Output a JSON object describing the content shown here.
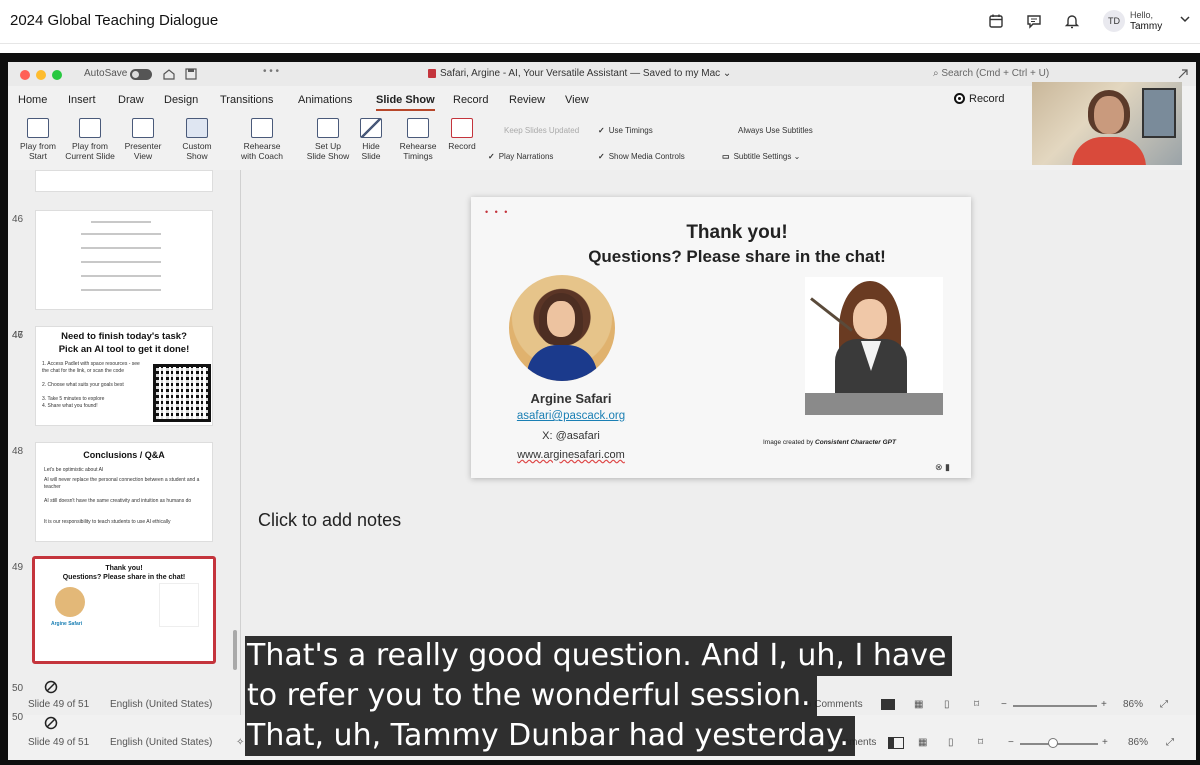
{
  "meeting": {
    "title": "2024 Global Teaching Dialogue",
    "avatar_initials": "TD",
    "greeting": "Hello,",
    "user_name": "Tammy"
  },
  "ppt": {
    "autosave_label": "AutoSave",
    "doc_title": "Safari, Argine - AI, Your Versatile Assistant  — Saved to my Mac ⌄",
    "search_placeholder": "Search (Cmd + Ctrl + U)",
    "menu": [
      "Home",
      "Insert",
      "Draw",
      "Design",
      "Transitions",
      "Animations",
      "Slide Show",
      "Record",
      "Review",
      "View"
    ],
    "active_menu": "Slide Show",
    "record_label": "Record",
    "ribbon": [
      {
        "l1": "Play from",
        "l2": "Start"
      },
      {
        "l1": "Play from",
        "l2": "Current Slide"
      },
      {
        "l1": "Presenter",
        "l2": "View"
      },
      {
        "l1": "Custom",
        "l2": "Show"
      },
      {
        "l1": "Rehearse",
        "l2": "with Coach"
      },
      {
        "l1": "Set Up",
        "l2": "Slide Show"
      },
      {
        "l1": "Hide",
        "l2": "Slide"
      },
      {
        "l1": "Rehearse",
        "l2": "Timings"
      },
      {
        "l1": "Record",
        "l2": ""
      }
    ],
    "options": {
      "keep_slides_updated": "Keep Slides Updated",
      "use_timings": "Use Timings",
      "always_use_subtitles": "Always Use Subtitles",
      "play_narrations": "Play Narrations",
      "show_media_controls": "Show Media Controls",
      "subtitle_settings": "Subtitle Settings ⌄"
    }
  },
  "slides_panel": {
    "numbers": [
      "46",
      "47",
      "48",
      "49",
      "50"
    ],
    "s47": {
      "title1": "Need to finish today's task?",
      "title2": "Pick an AI tool to get it done!",
      "bullets": [
        "1. Access Padlet with space resources - see the chat for the link, or scan the code",
        "2. Choose what suits your goals best",
        "3. Take 5 minutes to explore",
        "4. Share what you found!"
      ]
    },
    "s48": {
      "title": "Conclusions / Q&A",
      "bullets": [
        "Let's be optimistic about AI",
        "AI will never replace the personal connection between a student and a teacher",
        "AI still doesn't have the same creativity and intuition as humans do",
        "It is our responsibility to teach students to use AI ethically"
      ]
    },
    "s49": {
      "title1": "Thank you!",
      "title2": "Questions? Please share in the chat!",
      "name": "Argine Safari"
    }
  },
  "slide": {
    "title1": "Thank you!",
    "title2": "Questions? Please share in the chat!",
    "presenter_name": "Argine Safari",
    "email": "asafari@pascack.org",
    "x_handle": "X: @asafari",
    "website": "www.arginesafari.com",
    "credit_prefix": "Image created by",
    "credit_tool": "Consistent Character GPT"
  },
  "notes_placeholder": "Click to add notes",
  "status_bar": {
    "slide_count_back": "Slide 49 of 51",
    "slide_count": "Slide 49 of 51",
    "language": "English (United States)",
    "comments": "Comments",
    "zoom": "86%"
  },
  "captions": {
    "line1": "That's a really good question. And I, uh, I have",
    "line2": "to refer you to the wonderful session.",
    "line3a": "That, uh, Tammy Dunbar",
    "line3b": "had yesterday."
  },
  "colors": {
    "accent_red": "#c4343c",
    "link_blue": "#1a7fb4",
    "mac_close": "#ff5f57",
    "mac_min": "#febc2e",
    "mac_max": "#28c840"
  }
}
